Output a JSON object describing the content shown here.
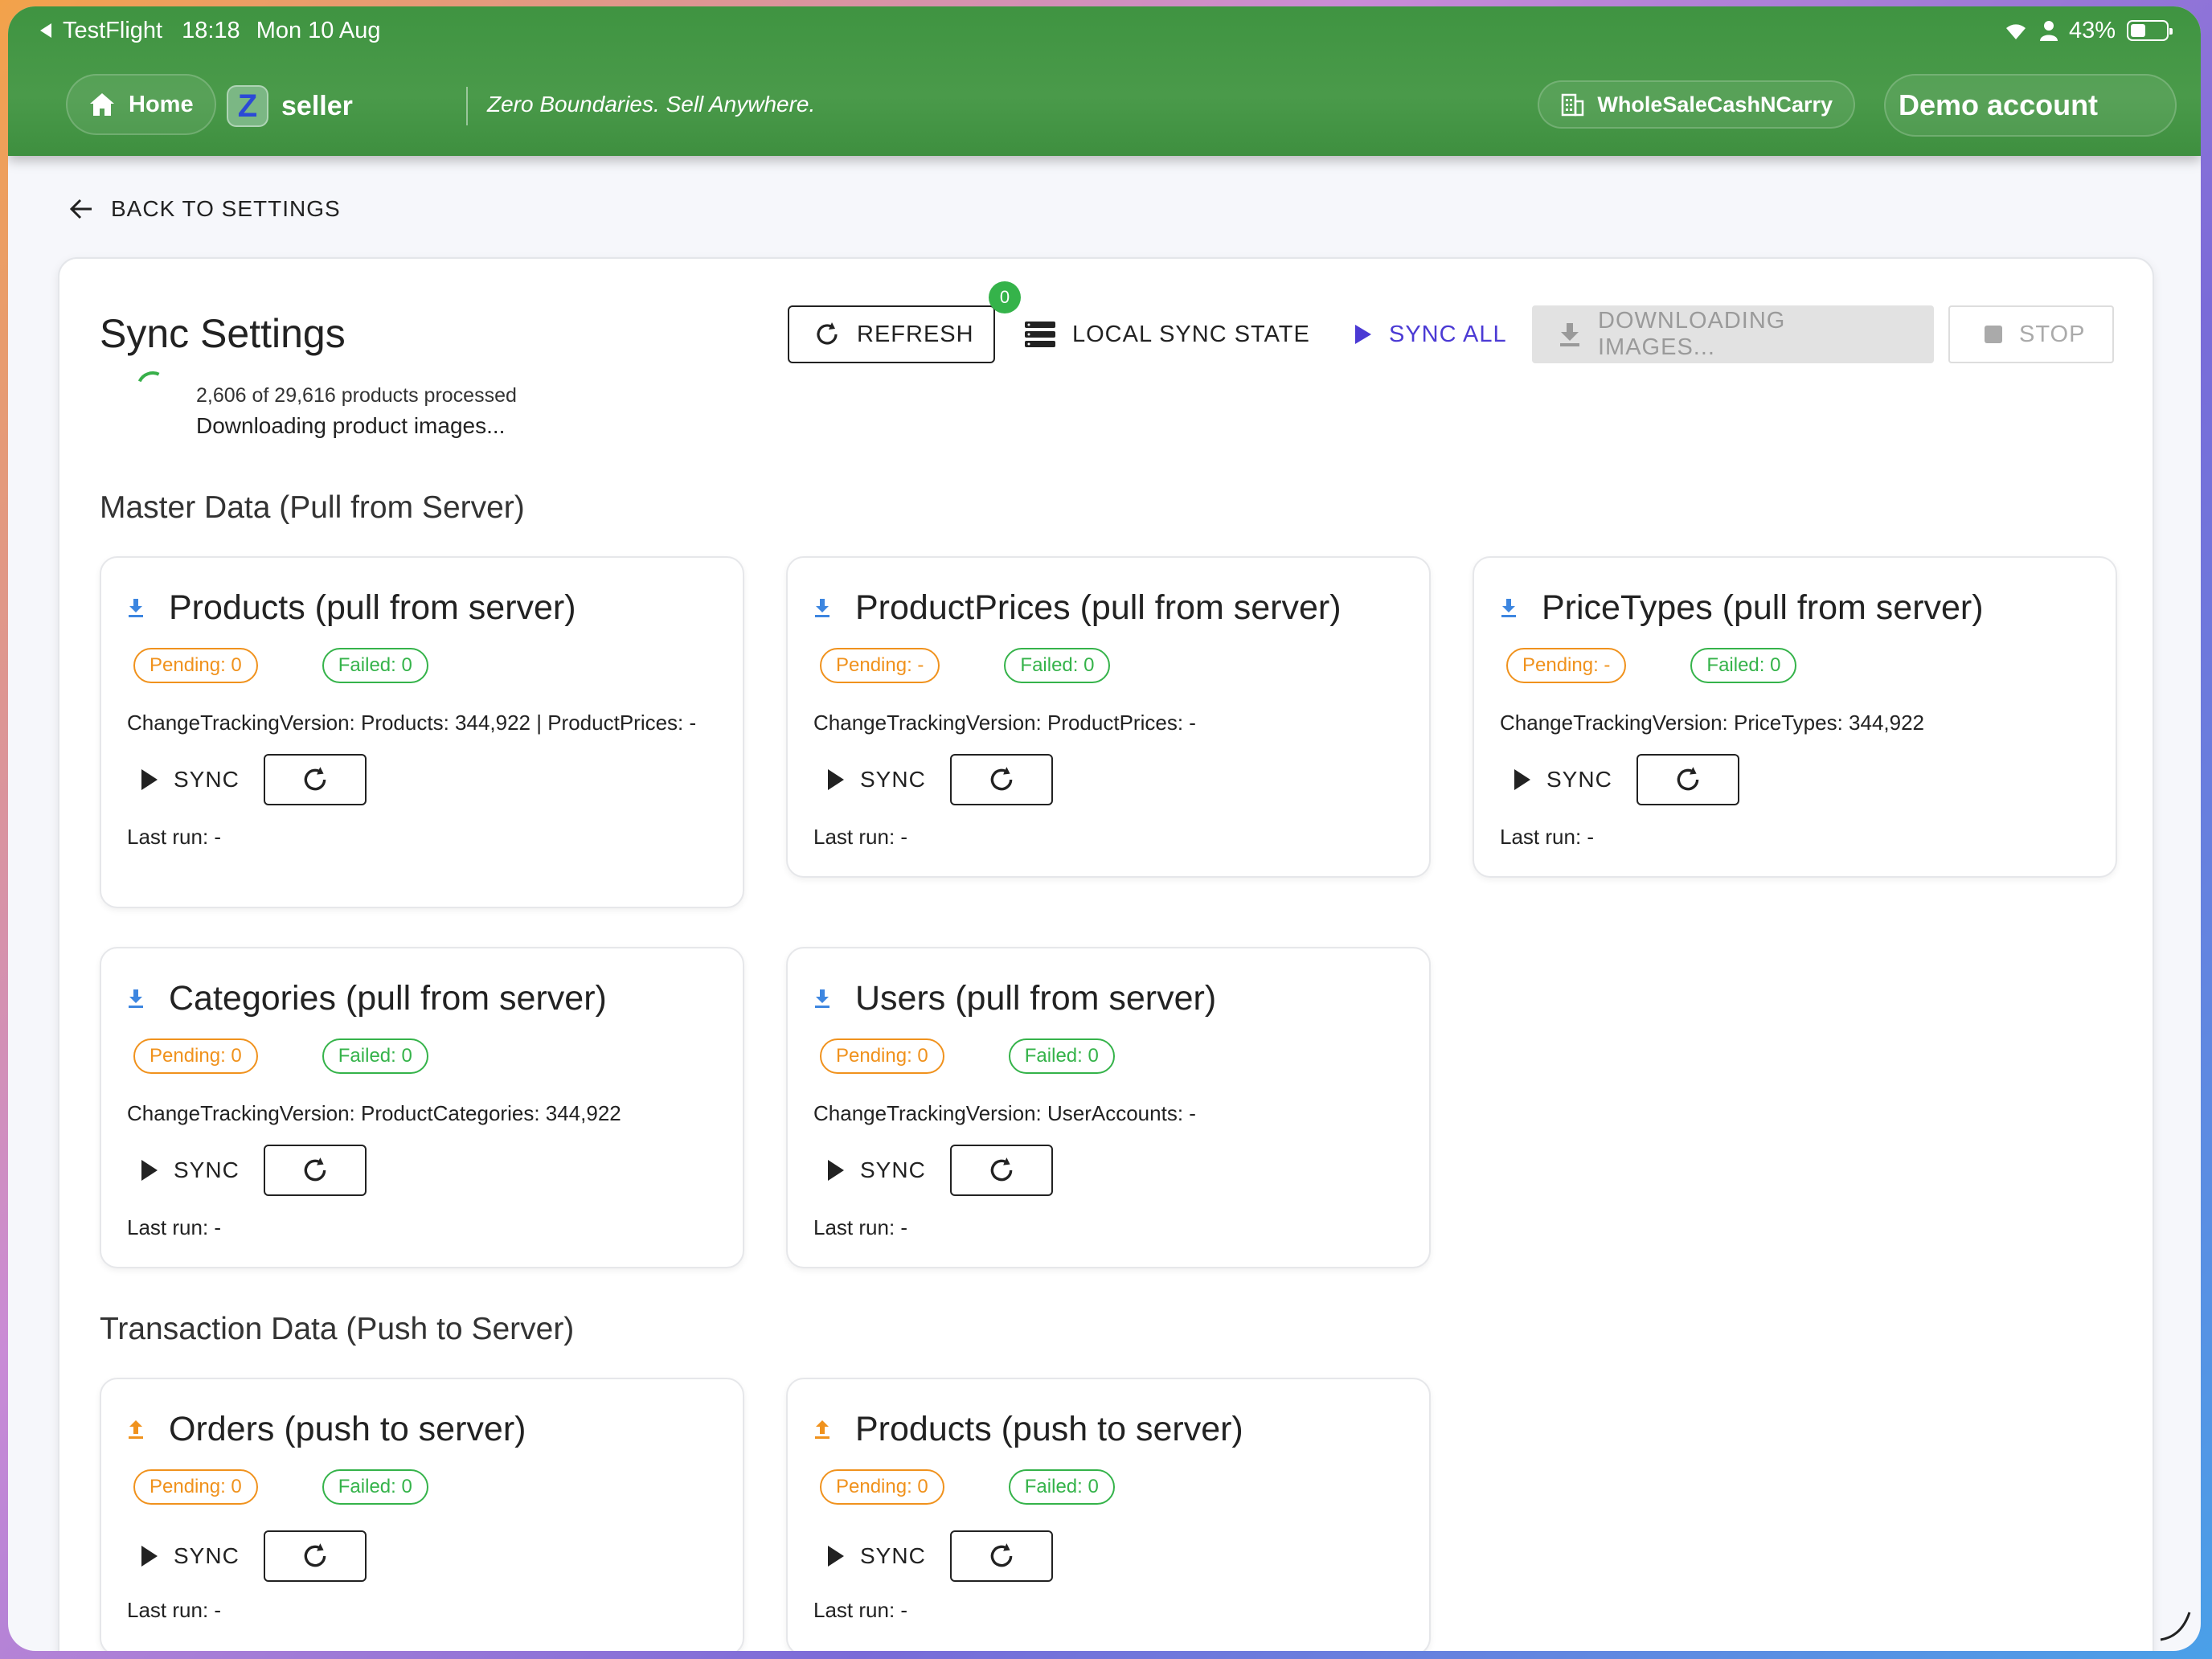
{
  "status_bar": {
    "back_app": "TestFlight",
    "time": "18:18",
    "date": "Mon 10 Aug",
    "battery": "43%",
    "battery_level": 0.43
  },
  "header": {
    "home_label": "Home",
    "brand_letter": "Z",
    "brand_name": "seller",
    "tagline": "Zero Boundaries. Sell Anywhere.",
    "store_name": "WholeSaleCashNCarry",
    "account_label": "Demo account",
    "colors": {
      "bar": "#4a9a4a"
    }
  },
  "back_link": "BACK TO SETTINGS",
  "panel": {
    "title": "Sync Settings",
    "toolbar": {
      "refresh_label": "REFRESH",
      "refresh_badge": "0",
      "local_label": "LOCAL SYNC STATE",
      "sync_all_label": "SYNC ALL",
      "downloading_label": "DOWNLOADING IMAGES...",
      "stop_label": "STOP"
    },
    "progress": {
      "count_text": "2,606 of 29,616 products processed",
      "status_text": "Downloading product images..."
    },
    "master_title": "Master Data (Pull from Server)",
    "transaction_title": "Transaction Data (Push to Server)",
    "master_cards": [
      {
        "title": "Products (pull from server)",
        "pending": "Pending: 0",
        "failed": "Failed: 0",
        "ctv": "ChangeTrackingVersion: Products: 344,922 | ProductPrices: -",
        "sync": "SYNC",
        "last_run": "Last run: -"
      },
      {
        "title": "ProductPrices (pull from server)",
        "pending": "Pending: -",
        "failed": "Failed: 0",
        "ctv": "ChangeTrackingVersion: ProductPrices: -",
        "sync": "SYNC",
        "last_run": "Last run: -"
      },
      {
        "title": "PriceTypes (pull from server)",
        "pending": "Pending: -",
        "failed": "Failed: 0",
        "ctv": "ChangeTrackingVersion: PriceTypes: 344,922",
        "sync": "SYNC",
        "last_run": "Last run: -"
      },
      {
        "title": "Categories (pull from server)",
        "pending": "Pending: 0",
        "failed": "Failed: 0",
        "ctv": "ChangeTrackingVersion: ProductCategories: 344,922",
        "sync": "SYNC",
        "last_run": "Last run: -"
      },
      {
        "title": "Users (pull from server)",
        "pending": "Pending: 0",
        "failed": "Failed: 0",
        "ctv": "ChangeTrackingVersion: UserAccounts: -",
        "sync": "SYNC",
        "last_run": "Last run: -"
      }
    ],
    "transaction_cards": [
      {
        "title": "Orders (push to server)",
        "pending": "Pending: 0",
        "failed": "Failed: 0",
        "sync": "SYNC",
        "last_run": "Last run: -"
      },
      {
        "title": "Products (push to server)",
        "pending": "Pending: 0",
        "failed": "Failed: 0",
        "sync": "SYNC",
        "last_run": "Last run: -"
      }
    ],
    "icons": {
      "pull": "download-arrow-icon",
      "push": "upload-arrow-icon",
      "pull_color": "#3d86e0",
      "push_color": "#f0921d"
    }
  }
}
